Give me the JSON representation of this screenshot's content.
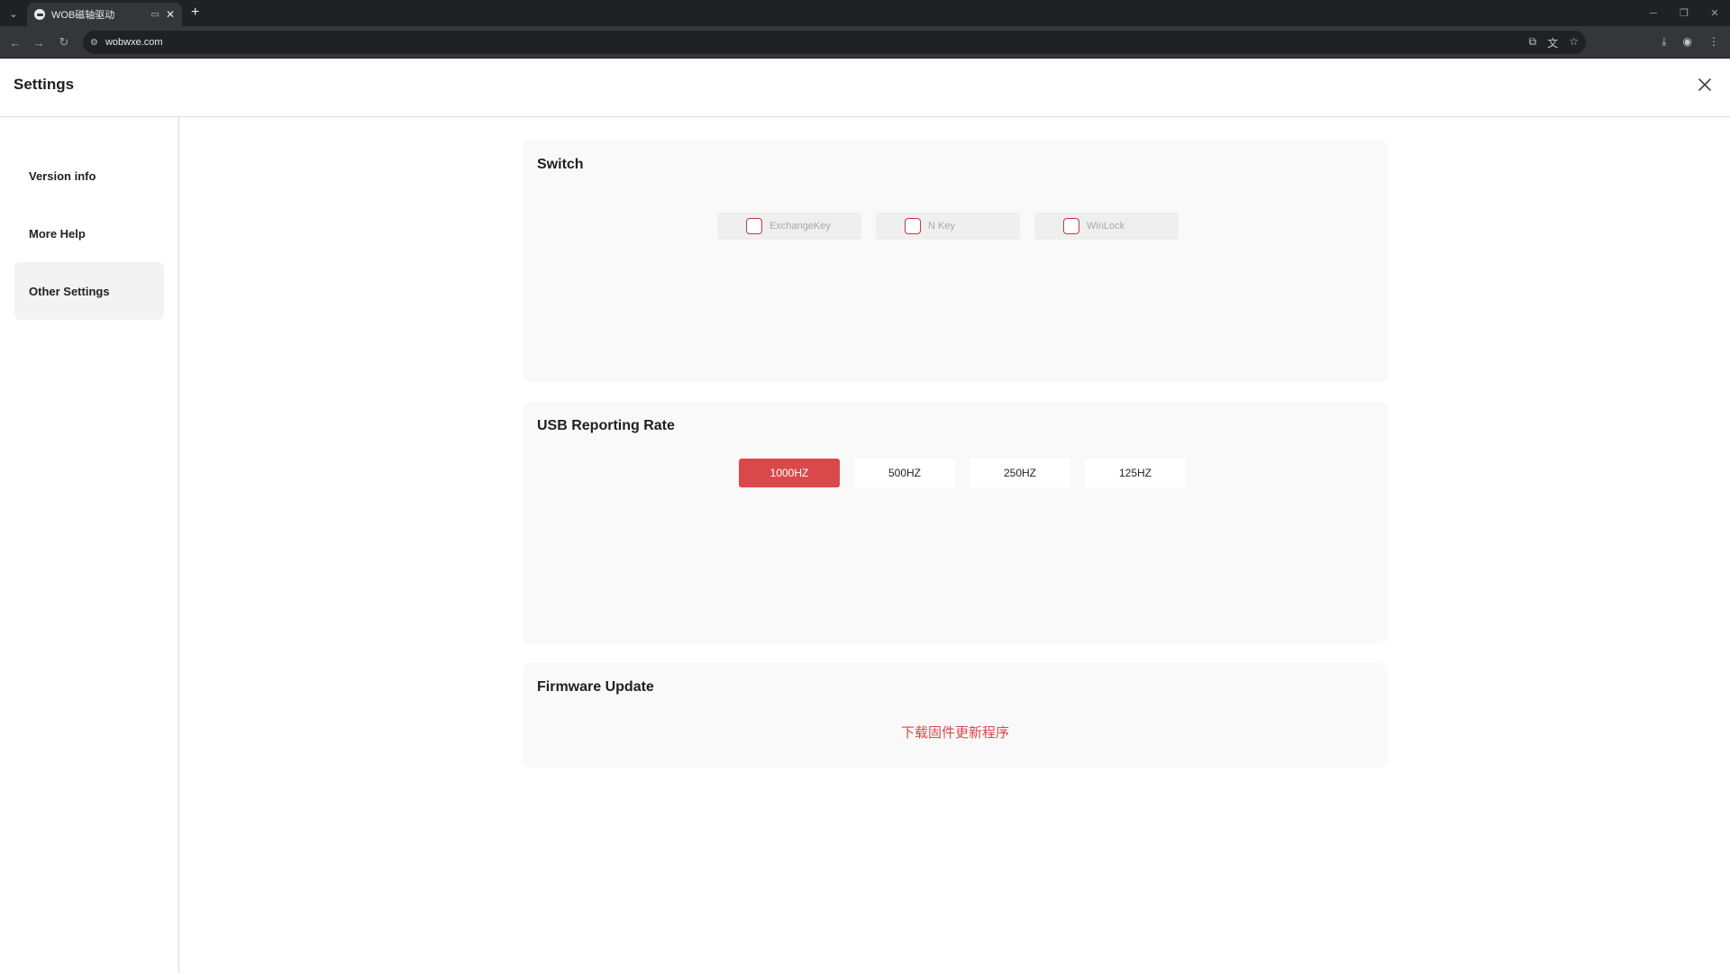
{
  "browser": {
    "tab_title": "WOB磁轴驱动",
    "url": "wobwxe.com",
    "tab_menu_icon": "chevron-down-icon",
    "new_tab_symbol": "+"
  },
  "app": {
    "title": "Settings",
    "accent_color": "#d9494b"
  },
  "sidebar": {
    "items": [
      {
        "label": "Version info",
        "active": false
      },
      {
        "label": "More Help",
        "active": false
      },
      {
        "label": "Other Settings",
        "active": true
      }
    ]
  },
  "switch_section": {
    "title": "Switch",
    "options": [
      {
        "label": "ExchangeKey",
        "checked": false
      },
      {
        "label": "N Key",
        "checked": false
      },
      {
        "label": "WinLock",
        "checked": false
      }
    ]
  },
  "usb_section": {
    "title": "USB Reporting Rate",
    "rates": [
      "1000HZ",
      "500HZ",
      "250HZ",
      "125HZ"
    ],
    "selected": "1000HZ"
  },
  "firmware_section": {
    "title": "Firmware Update",
    "link_text": "下载固件更新程序"
  }
}
